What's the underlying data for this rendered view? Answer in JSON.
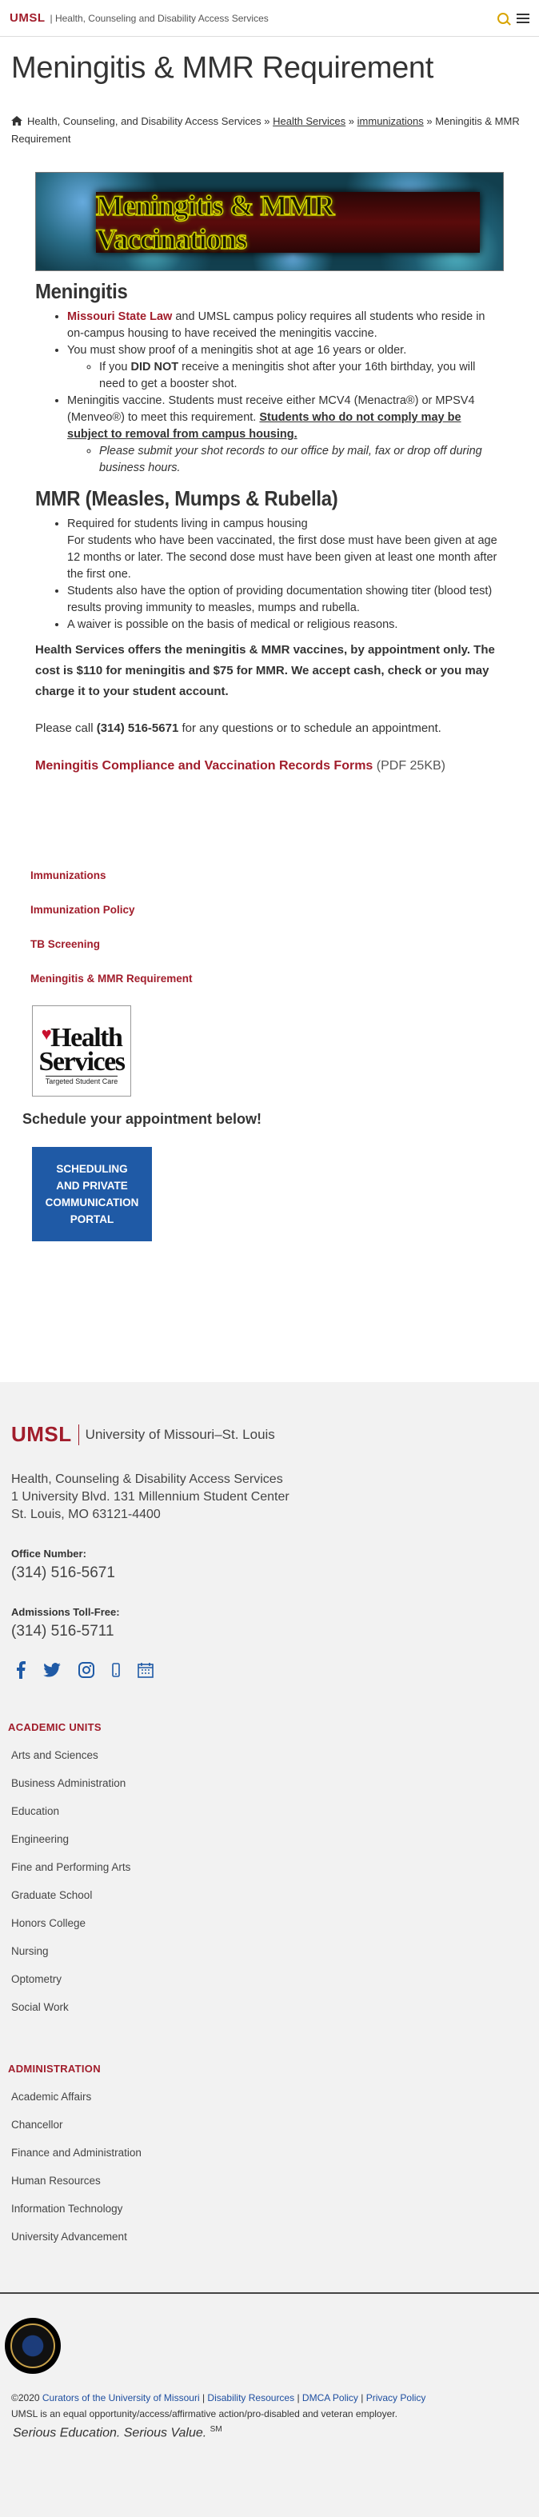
{
  "topbar": {
    "brand": "UMSL",
    "sitename": "| Health, Counseling and Disability Access Services"
  },
  "page": {
    "title": "Meningitis & MMR Requirement"
  },
  "breadcrumb": {
    "home": "Health, Counseling, and Disability Access Services",
    "sep": "»",
    "crumb1": "Health Services",
    "crumb2": "immunizations",
    "current": "Meningitis & MMR Requirement"
  },
  "banner": {
    "text": "Meningitis & MMR Vaccinations"
  },
  "meningitis": {
    "heading": "Meningitis",
    "b1_link": "Missouri State Law",
    "b1_text": " and UMSL campus policy requires all students who reside in on-campus housing to have received the meningitis vaccine.",
    "b2": "You must show proof of a meningitis shot at age 16 years or older.",
    "b2a_pre": "If you ",
    "b2a_strong": "DID NOT",
    "b2a_post": " receive a meningitis shot after your 16th birthday, you will need to get a booster shot.",
    "b3_text": "Meningitis vaccine. Students must receive either MCV4 (Menactra®) or MPSV4 (Menveo®) to meet this requirement. ",
    "b3_strong": "Students who do not comply may be subject to removal from campus housing.",
    "b3a": "Please submit your shot records to our office by mail, fax or drop off during business hours."
  },
  "mmr": {
    "heading": "MMR (Measles, Mumps & Rubella)",
    "b1_line1": "Required for students living in campus housing",
    "b1_line2": "For students who have been vaccinated, the first dose must have been given at age 12 months or later. The second dose must have been given at least one month after the first one.",
    "b2": "Students also have the option of providing documentation showing titer (blood test) results proving immunity to measles, mumps and rubella.",
    "b3": "A waiver is possible on the basis of medical or religious reasons."
  },
  "offer": {
    "text": "Health Services offers the meningitis & MMR vaccines, by appointment only. The cost is $110 for meningitis and $75 for MMR. We accept cash, check or you may charge it to your student account."
  },
  "call": {
    "pre": "Please call ",
    "phone": "(314) 516-5671",
    "post": " for any questions or to schedule an appointment."
  },
  "forms": {
    "link": "Meningitis Compliance and Vaccination Records Forms",
    "size": " (PDF 25KB)"
  },
  "sidenav": {
    "items": [
      "Immunizations",
      "Immunization Policy",
      "TB Screening",
      "Meningitis & MMR Requirement"
    ]
  },
  "hs_logo": {
    "line1": "Health",
    "line2": "Services",
    "tagline": "Targeted Student Care"
  },
  "schedule": {
    "heading": "Schedule your appointment below!",
    "button": "SCHEDULING AND PRIVATE COMMUNICATION PORTAL"
  },
  "footer": {
    "brand": "UMSL",
    "university": "University of Missouri–St. Louis",
    "address1": "Health, Counseling & Disability Access Services",
    "address2": "1 University Blvd. 131 Millennium Student Center",
    "address3": "St. Louis, MO 63121-4400",
    "office_label": "Office Number:",
    "office_phone": "(314) 516-5671",
    "admissions_label": "Admissions Toll-Free:",
    "admissions_phone": "(314) 516-5711",
    "social_icons": [
      "facebook-icon",
      "twitter-icon",
      "instagram-icon",
      "mobile-icon",
      "calendar-icon"
    ],
    "academic_heading": "ACADEMIC UNITS",
    "academic_units": [
      "Arts and Sciences",
      "Business Administration",
      "Education",
      "Engineering",
      "Fine and Performing Arts",
      "Graduate School",
      "Honors College",
      "Nursing",
      "Optometry",
      "Social Work"
    ],
    "admin_heading": "ADMINISTRATION",
    "admin_units": [
      "Academic Affairs",
      "Chancellor",
      "Finance and Administration",
      "Human Resources",
      "Information Technology",
      "University Advancement"
    ],
    "copyright_pre": "©2020 ",
    "copyright_link": "Curators of the University of Missouri",
    "legal_links": [
      "Disability Resources",
      "DMCA Policy",
      "Privacy Policy"
    ],
    "eo_statement": "UMSL is an equal opportunity/access/affirmative action/pro-disabled and veteran employer.",
    "slogan": "Serious Education. Serious Value.",
    "slogan_mark": "SM"
  },
  "colors": {
    "brand_red": "#a11d2b",
    "portal_blue": "#1f5aa6",
    "footer_bg": "#f2f2f2"
  }
}
